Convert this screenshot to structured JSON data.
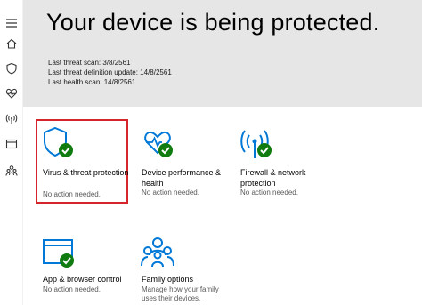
{
  "hero": {
    "title": "Your device is being protected.",
    "info": [
      "Last threat scan:  3/8/2561",
      "Last threat definition update:  14/8/2561",
      "Last health scan:  14/8/2561"
    ]
  },
  "nav": {
    "items": [
      {
        "icon": "menu-icon"
      },
      {
        "icon": "home-icon"
      },
      {
        "icon": "shield-icon"
      },
      {
        "icon": "heart-health-icon"
      },
      {
        "icon": "wifi-antenna-icon"
      },
      {
        "icon": "browser-icon"
      },
      {
        "icon": "family-icon"
      }
    ]
  },
  "tiles": [
    {
      "title": "Virus & threat protection",
      "status": "No action needed.",
      "icon": "shield-icon",
      "selected": true
    },
    {
      "title": "Device performance & health",
      "status": "No action needed.",
      "icon": "heart-health-icon"
    },
    {
      "title": "Firewall & network protection",
      "status": "No action needed.",
      "icon": "wifi-antenna-icon"
    },
    {
      "title": "App & browser control",
      "status": "No action needed.",
      "icon": "browser-window-icon"
    },
    {
      "title": "Family options",
      "status": "Manage how your family uses their devices.",
      "icon": "family-icon"
    }
  ],
  "colors": {
    "accent": "#0078d7",
    "check": "#107c10",
    "selected_border": "#d6242b",
    "banner": "#e6e6e6"
  }
}
